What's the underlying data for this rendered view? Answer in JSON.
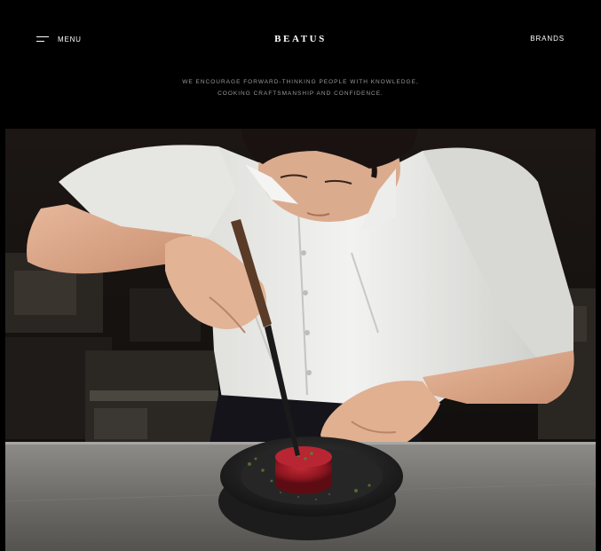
{
  "header": {
    "menu_label": "MENU",
    "brand_name": "BEATUS",
    "brands_label": "BRANDS"
  },
  "tagline": {
    "line1": "WE ENCOURAGE FORWARD-THINKING PEOPLE WITH KNOWLEDGE,",
    "line2": "COOKING CRAFTSMANSHIP AND CONFIDENCE."
  },
  "icons": {
    "menu": "hamburger-menu-icon"
  },
  "colors": {
    "background": "#000000",
    "text": "#ffffff",
    "tagline_text": "#9a9a9a"
  }
}
